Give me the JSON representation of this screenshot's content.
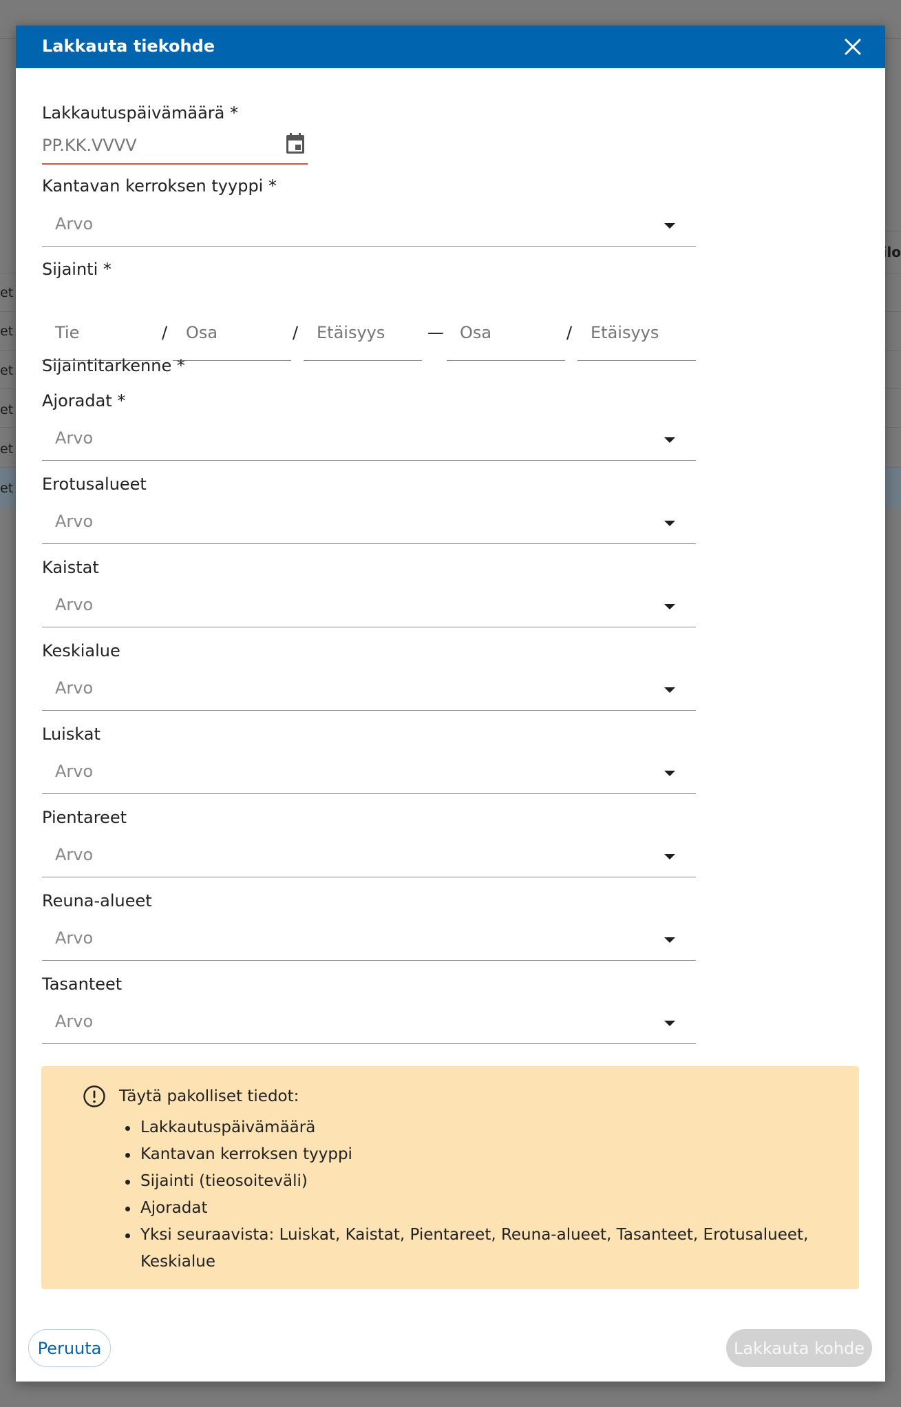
{
  "background": {
    "row_fragments": [
      "et",
      "et",
      "et",
      "et",
      "et",
      "et"
    ],
    "header_fragment": "ilo"
  },
  "modal": {
    "title": "Lakkauta tiekohde",
    "close_label": "×"
  },
  "form": {
    "date": {
      "label": "Lakkautuspäivämäärä",
      "required_mark": "*",
      "placeholder": "PP.KK.VVVV",
      "value": ""
    },
    "layer_type": {
      "label": "Kantavan kerroksen tyyppi",
      "required_mark": "*",
      "value": "Arvo"
    },
    "location": {
      "label": "Sijainti",
      "required_mark": "*",
      "fields": [
        {
          "placeholder": "Tie"
        },
        {
          "placeholder": "Osa"
        },
        {
          "placeholder": "Etäisyys"
        },
        {
          "placeholder": "Osa"
        },
        {
          "placeholder": "Etäisyys"
        }
      ],
      "separators": [
        "/",
        "/",
        "—",
        "/"
      ]
    },
    "location_detail": {
      "label": "Sijaintitarkenne",
      "required_mark": "*"
    },
    "selects": [
      {
        "label": "Ajoradat",
        "required_mark": "*",
        "value": "Arvo"
      },
      {
        "label": "Erotusalueet",
        "required_mark": "",
        "value": "Arvo"
      },
      {
        "label": "Kaistat",
        "required_mark": "",
        "value": "Arvo"
      },
      {
        "label": "Keskialue",
        "required_mark": "",
        "value": "Arvo"
      },
      {
        "label": "Luiskat",
        "required_mark": "",
        "value": "Arvo"
      },
      {
        "label": "Pientareet",
        "required_mark": "",
        "value": "Arvo"
      },
      {
        "label": "Reuna-alueet",
        "required_mark": "",
        "value": "Arvo"
      },
      {
        "label": "Tasanteet",
        "required_mark": "",
        "value": "Arvo"
      }
    ]
  },
  "alert": {
    "title": "Täytä pakolliset tiedot:",
    "items": [
      "Lakkautuspäivämäärä",
      "Kantavan kerroksen tyyppi",
      "Sijainti (tieosoiteväli)",
      "Ajoradat",
      "Yksi seuraavista: Luiskat, Kaistat, Pientareet, Reuna-alueet, Tasanteet, Erotusalueet, Keskialue"
    ]
  },
  "buttons": {
    "cancel": "Peruuta",
    "submit": "Lakkauta kohde"
  },
  "colors": {
    "header": "#0064af",
    "alert_bg": "#fde2b3",
    "error_underline": "#d9534f",
    "disabled_button": "#d2d2d2"
  }
}
